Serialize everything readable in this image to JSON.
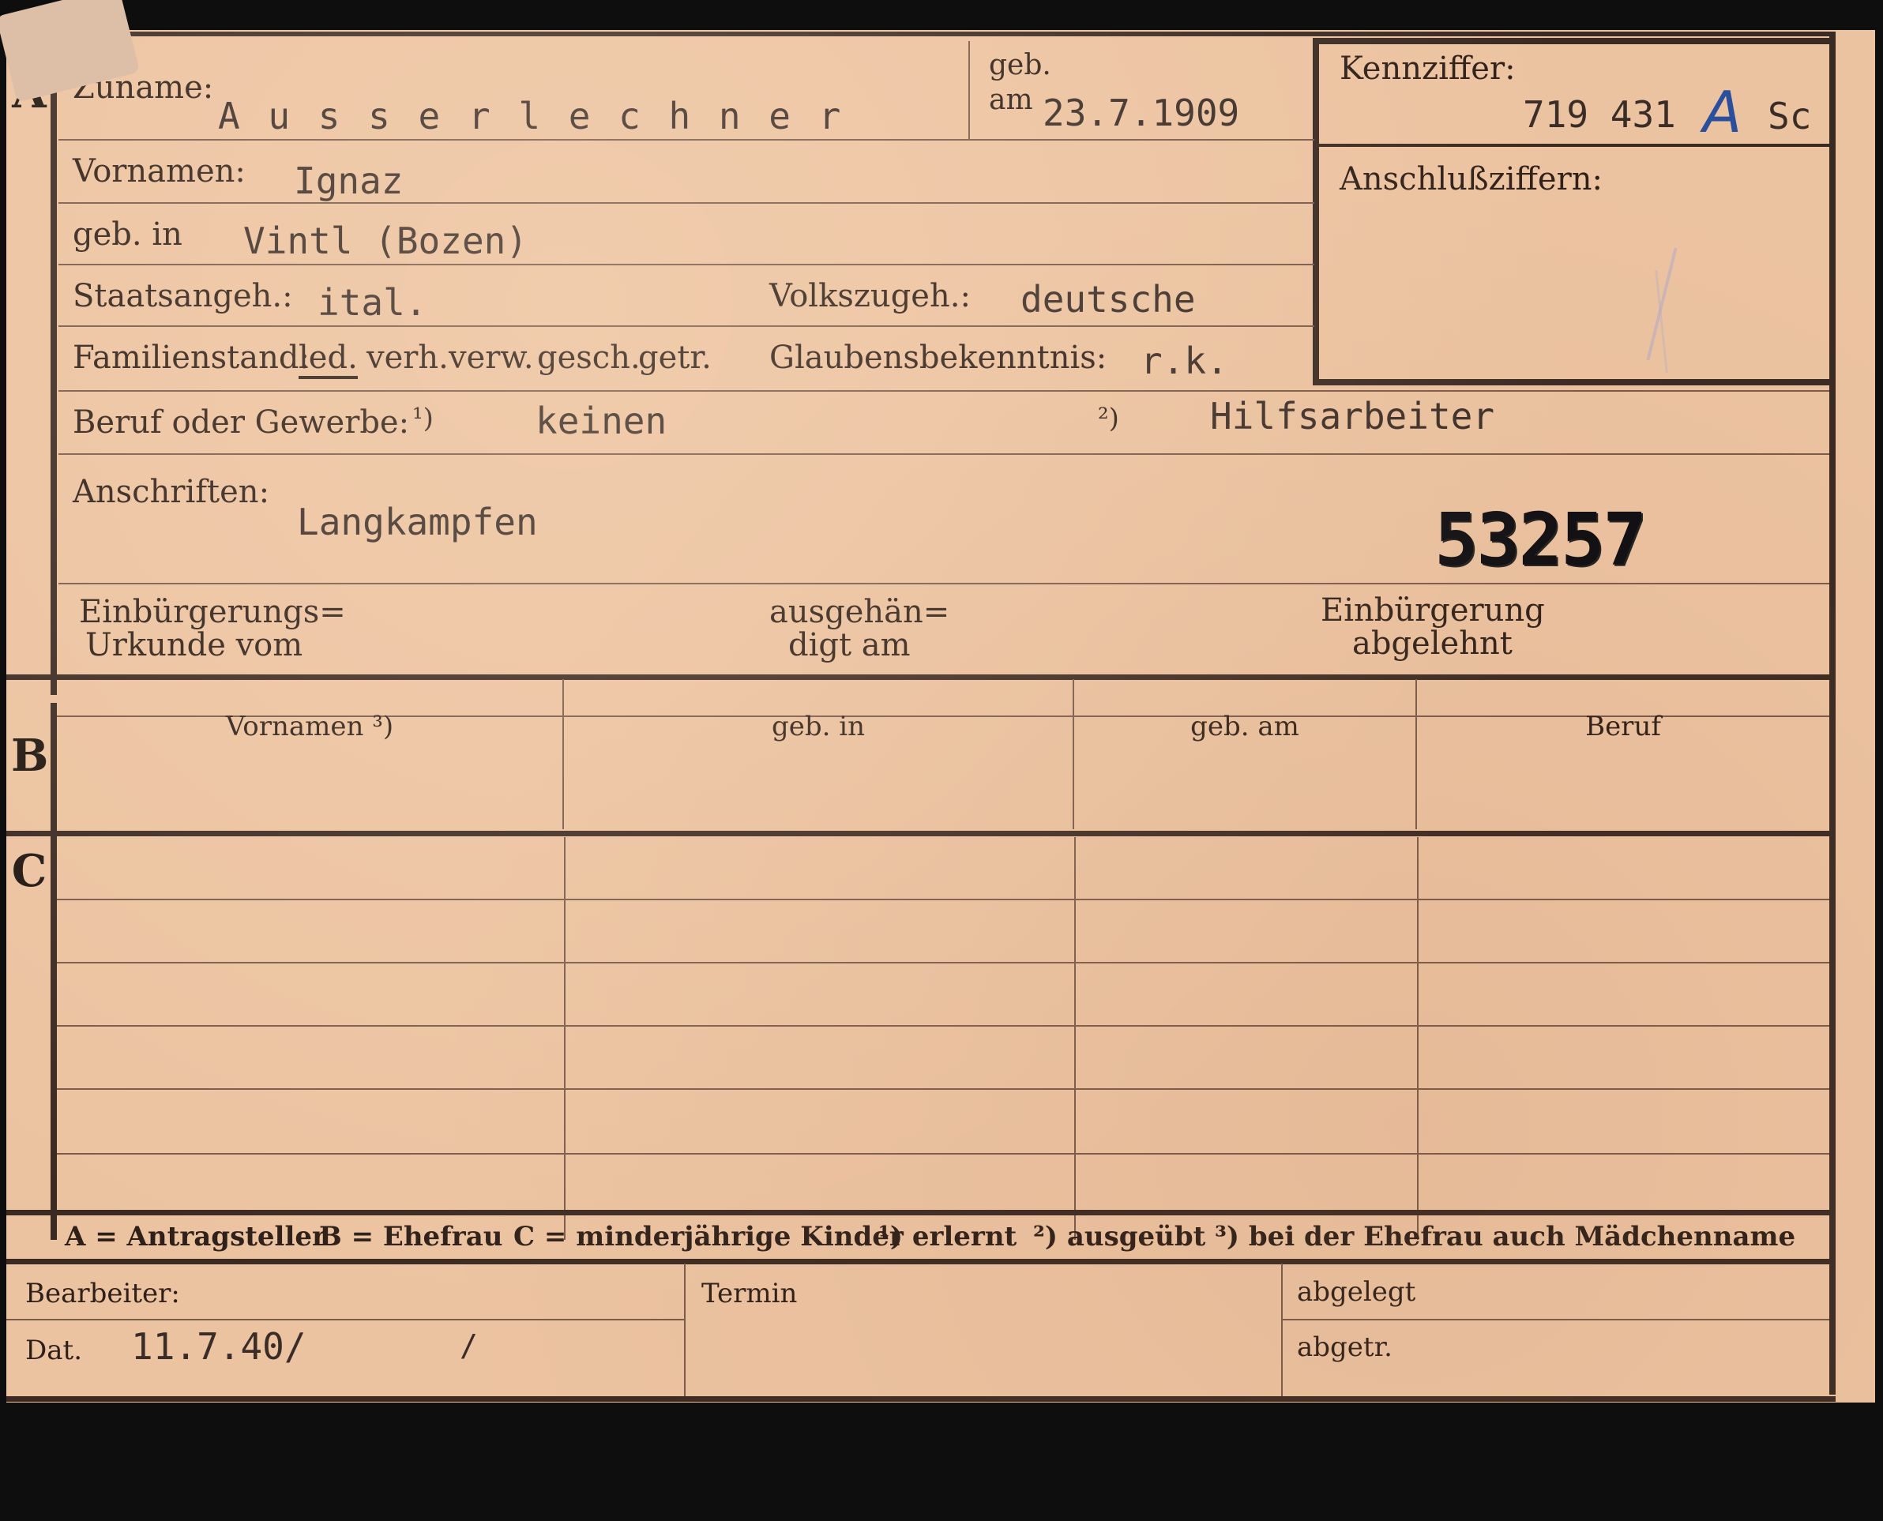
{
  "section_a": {
    "letter": "A",
    "surname_label": "Zuname:",
    "surname_value": "A u s s e r l e c h n e r",
    "birth_label_1": "geb.",
    "birth_label_2": "am",
    "birth_date": "23.7.1909",
    "id_label": "Kennziffer:",
    "id_value": "719 431",
    "id_mark": "A",
    "id_suffix": "Sc",
    "link_label": "Anschlußziffern:",
    "firstnames_label": "Vornamen:",
    "firstnames_value": "Ignaz",
    "birthplace_label": "geb. in",
    "birthplace_value": "Vintl (Bozen)",
    "citizenship_label": "Staatsangeh.:",
    "citizenship_value": "ital.",
    "ethnicity_label": "Volkszugeh.:",
    "ethnicity_value": "deutsche",
    "marital_label": "Familienstand:",
    "marital_options": [
      "led.",
      "verh.",
      "verw.",
      "gesch.",
      "getr."
    ],
    "marital_selected": "led.",
    "religion_label": "Glaubensbekenntnis:",
    "religion_value": "r.k.",
    "profession_label": "Beruf oder Gewerbe:",
    "profession_note_1": "¹)",
    "profession_value_1": "keinen",
    "profession_note_2": "²)",
    "profession_value_2": "Hilfsarbeiter",
    "address_label": "Anschriften:",
    "address_value": "Langkampfen",
    "stamp_number": "53257",
    "naturalization_cert_label_1": "Einbürgerungs=",
    "naturalization_cert_label_2": "Urkunde vom",
    "handed_out_label_1": "ausgehän=",
    "handed_out_label_2": "digt am",
    "naturalization_denied_label_1": "Einbürgerung",
    "naturalization_denied_label_2": "abgelehnt"
  },
  "section_b": {
    "letter": "B",
    "columns": [
      "Vornamen ³)",
      "geb. in",
      "geb. am",
      "Beruf"
    ]
  },
  "section_c": {
    "letter": "C"
  },
  "legend": {
    "a": "A = Antragsteller",
    "b": "B = Ehefrau",
    "c": "C = minderjährige Kinder",
    "n1": "¹) erlernt",
    "n2": "²) ausgeübt",
    "n3": "³) bei der Ehefrau auch Mädchenname"
  },
  "footer": {
    "clerk_label": "Bearbeiter:",
    "date_label": "Dat.",
    "date_value": "11.7.40/",
    "date_slash": "/",
    "deadline_label": "Termin",
    "filed_label": "abgelegt",
    "removed_label": "abgetr."
  },
  "colors": {
    "paper": "#ecc3a1",
    "ink": "#2e1f18",
    "typewriter": "#3a2d28",
    "pen_blue": "#2a4f9c",
    "background": "#0e0e0e"
  }
}
